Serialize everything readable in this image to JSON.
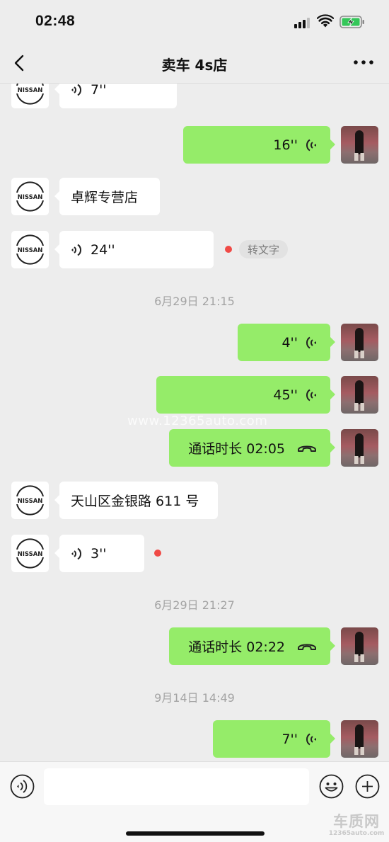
{
  "status_bar": {
    "time": "02:48"
  },
  "nav": {
    "title": "卖车 4s店"
  },
  "nissan_logo_text": "NISSAN",
  "messages": [
    {
      "side": "left",
      "type": "voice",
      "duration": "7''"
    },
    {
      "side": "right",
      "type": "voice",
      "duration": "16''"
    },
    {
      "side": "left",
      "type": "text",
      "text": "卓辉专营店"
    },
    {
      "side": "left",
      "type": "voice",
      "duration": "24''",
      "unread": true,
      "transcribe_label": "转文字"
    },
    {
      "timestamp": "6月29日 21:15"
    },
    {
      "side": "right",
      "type": "voice",
      "duration": "4''"
    },
    {
      "side": "right",
      "type": "voice",
      "duration": "45''"
    },
    {
      "side": "right",
      "type": "call",
      "text": "通话时长 02:05"
    },
    {
      "side": "left",
      "type": "text",
      "text": "天山区金银路 611 号"
    },
    {
      "side": "left",
      "type": "voice",
      "duration": "3''",
      "unread": true
    },
    {
      "timestamp": "6月29日 21:27"
    },
    {
      "side": "right",
      "type": "call",
      "text": "通话时长 02:22"
    },
    {
      "timestamp": "9月14日 14:49"
    },
    {
      "side": "right",
      "type": "voice",
      "duration": "7''"
    }
  ],
  "watermark": "www.12365auto.com",
  "input": {
    "placeholder": ""
  },
  "brand": {
    "main": "车质网",
    "sub": "12365auto.com"
  },
  "colors": {
    "sent_bubble": "#95ec69",
    "received_bubble": "#ffffff",
    "background": "#ededed",
    "unread_dot": "#f04a46"
  }
}
